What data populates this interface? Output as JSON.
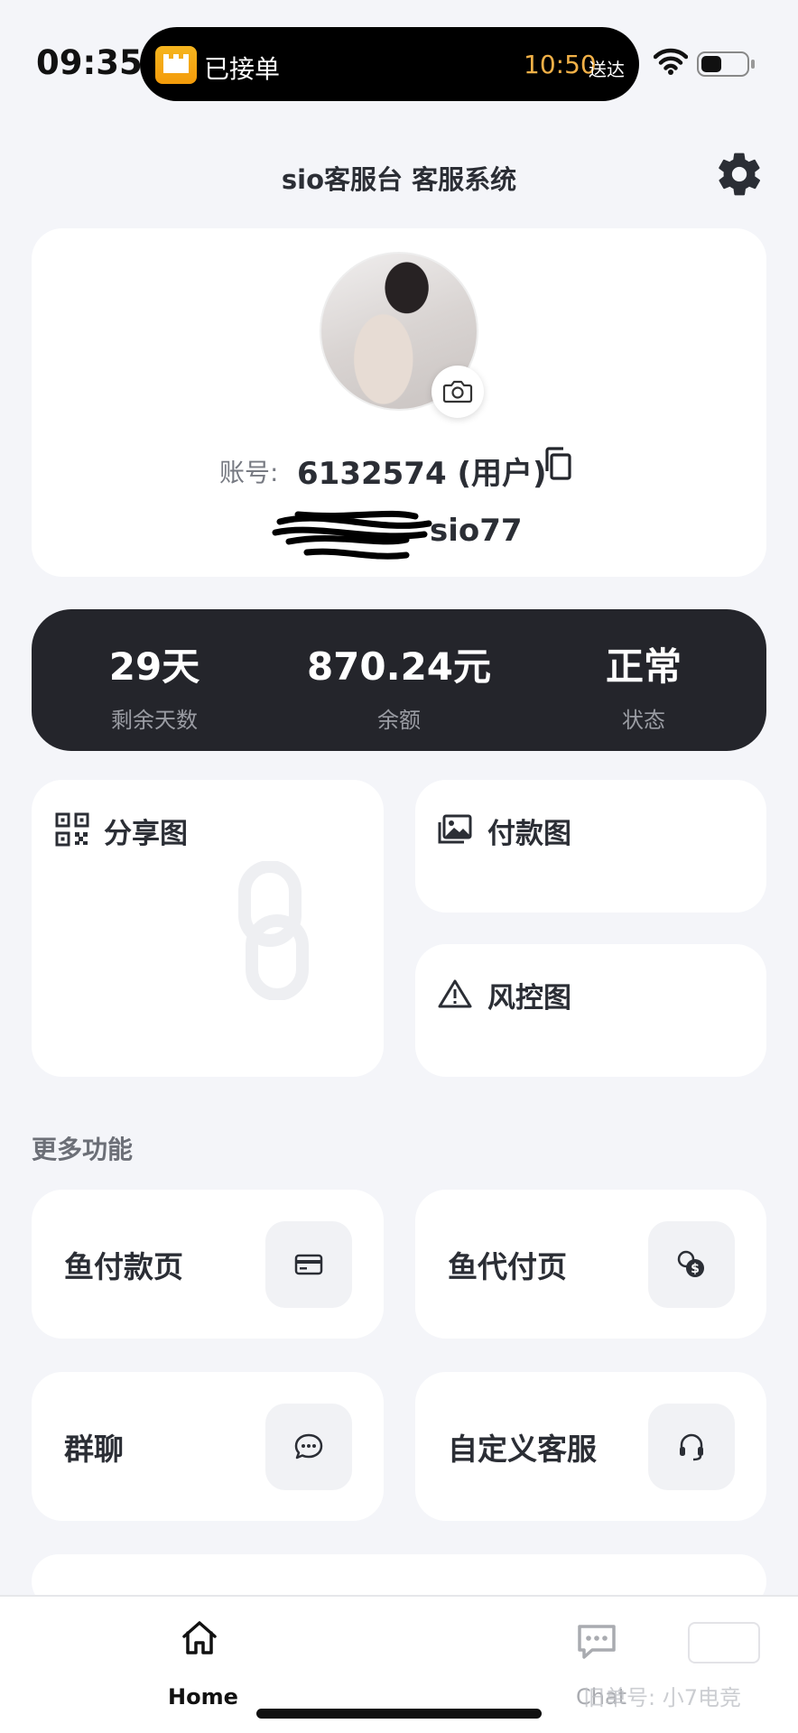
{
  "status_bar": {
    "time": "09:35",
    "island_label": "已接单",
    "island_time": "10:50",
    "island_sub": "送达"
  },
  "header": {
    "title": "sio客服台 客服系统"
  },
  "profile": {
    "account_label": "账号:",
    "account_value": "6132574 (用户)",
    "nickname": "sio77"
  },
  "stats": [
    {
      "value": "29天",
      "label": "剩余天数"
    },
    {
      "value": "870.24元",
      "label": "余额"
    },
    {
      "value": "正常",
      "label": "状态"
    }
  ],
  "features": {
    "share": "分享图",
    "pay": "付款图",
    "risk": "风控图"
  },
  "more": {
    "title": "更多功能",
    "tiles": [
      {
        "label": "鱼付款页",
        "icon": "card-icon"
      },
      {
        "label": "鱼代付页",
        "icon": "coins-icon"
      },
      {
        "label": "群聊",
        "icon": "chat-bubble-icon"
      },
      {
        "label": "自定义客服",
        "icon": "headset-icon"
      }
    ]
  },
  "tabbar": {
    "home": "Home",
    "chat": "Chat"
  },
  "watermark": {
    "text": "旧单号: 小7电竞"
  },
  "colors": {
    "background": "#f4f5f9",
    "stats_bg": "#24252b",
    "island_accent": "#f1b047"
  }
}
